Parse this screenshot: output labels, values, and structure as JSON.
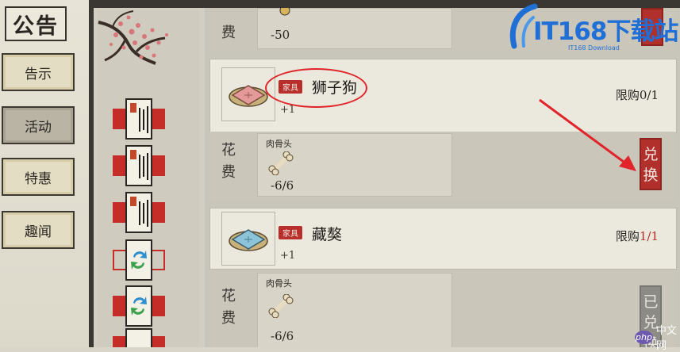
{
  "nav": {
    "title": "公告",
    "items": [
      {
        "label": "告示"
      },
      {
        "label": "活动"
      },
      {
        "label": "特惠"
      },
      {
        "label": "趣闻"
      }
    ]
  },
  "top_partial": {
    "cost_char": "费",
    "cost_amount": "-50"
  },
  "items": [
    {
      "tag": "家具",
      "name": "狮子狗",
      "qty": "+1",
      "limit_label": "限购",
      "limit_count": "0/1",
      "cost_label_top": "花",
      "cost_label_bottom": "费",
      "cost_name": "肉骨头",
      "cost_amount": "-6/6",
      "button_chars": [
        "兑",
        "换"
      ],
      "button_state": "available"
    },
    {
      "tag": "家具",
      "name": "藏獒",
      "qty": "+1",
      "limit_label": "限购",
      "limit_count": "1/1",
      "cost_label_top": "花",
      "cost_label_bottom": "费",
      "cost_name": "肉骨头",
      "cost_amount": "-6/6",
      "button_chars": [
        "已",
        "兑",
        "换"
      ],
      "button_state": "redeemed"
    }
  ],
  "watermark": {
    "logo_text": "IT168下载站",
    "logo_sub": "IT168 Download",
    "bottom_text": "中文网",
    "bottom_badge": "php"
  },
  "colors": {
    "accent_red": "#b72e2a",
    "watermark_blue": "#1f6fd6",
    "annotation_red": "#e0242a"
  }
}
